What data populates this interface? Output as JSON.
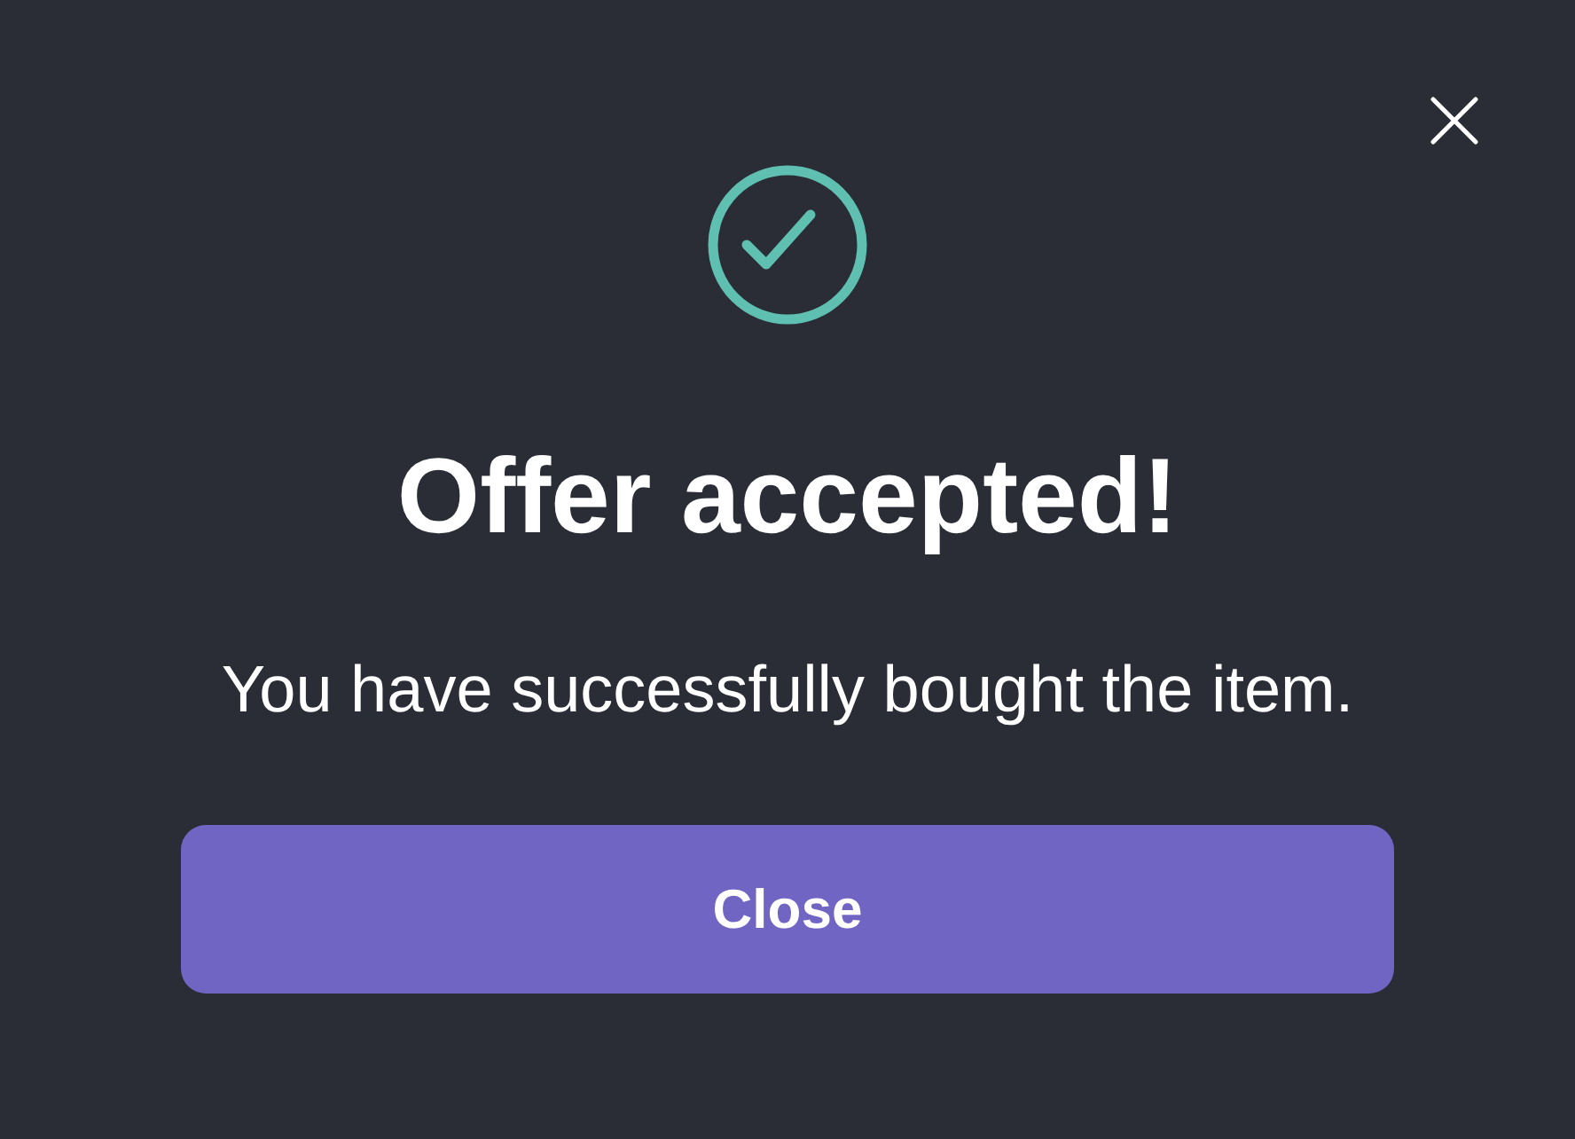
{
  "dialog": {
    "title": "Offer accepted!",
    "message": "You have successfully bought the item.",
    "button": "Close"
  }
}
